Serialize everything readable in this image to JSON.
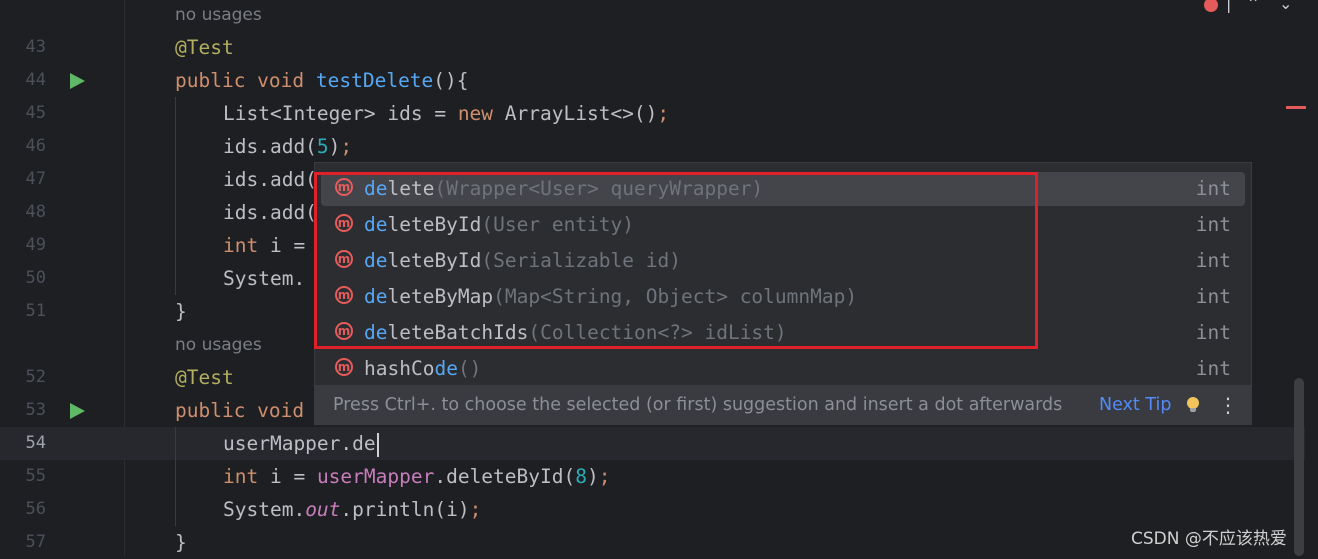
{
  "gutter": {
    "line_numbers": [
      "43",
      "44",
      "45",
      "46",
      "47",
      "48",
      "49",
      "50",
      "51",
      "52",
      "53",
      "54",
      "55",
      "56",
      "57"
    ]
  },
  "hints": {
    "usage1": "no usages",
    "usage2": "no usages"
  },
  "code": {
    "l43": "@Test",
    "l44_kw": "public void ",
    "l44_fn": "testDelete",
    "l44_rest": "(){",
    "l45_a": "List<Integer> ids = ",
    "l45_kw": "new",
    "l45_b": " ArrayList<>()",
    "l45_semi": ";",
    "l46_a": "ids.add(",
    "l46_num": "5",
    "l46_b": ")",
    "l46_semi": ";",
    "l47": "ids.add(",
    "l48": "ids.add(",
    "l49_kw": "int",
    "l49_b": " i = ",
    "l50": "System.",
    "l51": "}",
    "l52": "@Test",
    "l53_kw": "public void",
    "l54": "userMapper.de",
    "l55_kw": "int",
    "l55_a": " i = ",
    "l55_field": "userMapper",
    "l55_b": ".deleteById(",
    "l55_num": "8",
    "l55_c": ")",
    "l55_semi": ";",
    "l56_a": "System.",
    "l56_static": "out",
    "l56_b": ".println(i)",
    "l56_semi": ";",
    "l57": "}"
  },
  "completion": {
    "items": [
      {
        "match": "de",
        "rest": "lete",
        "sig": "(Wrapper<User> queryWrapper)",
        "type": "int",
        "selected": true
      },
      {
        "match": "de",
        "rest": "leteById",
        "sig": "(User entity)",
        "type": "int"
      },
      {
        "match": "de",
        "rest": "leteById",
        "sig": "(Serializable id)",
        "type": "int"
      },
      {
        "match": "de",
        "rest": "leteByMap",
        "sig": "(Map<String, Object> columnMap)",
        "type": "int"
      },
      {
        "match": "de",
        "rest": "leteBatchIds",
        "sig": "(Collection<?> idList)",
        "type": "int"
      },
      {
        "pre": "hashCo",
        "match2": "de",
        "sig": "()",
        "type": "int"
      }
    ],
    "icon_letter": "m",
    "footer_text": "Press Ctrl+. to choose the selected (or first) suggestion and insert a dot afterwards",
    "next_tip": "Next Tip",
    "more": "⋮"
  },
  "watermark": "CSDN @不应该热爱",
  "colors": {
    "background": "#1e1f22",
    "keyword": "#cf8e6d",
    "function": "#56a8f5",
    "number": "#2aacb8",
    "annotation": "#b3ae60",
    "highlight_box": "#e1212a"
  }
}
